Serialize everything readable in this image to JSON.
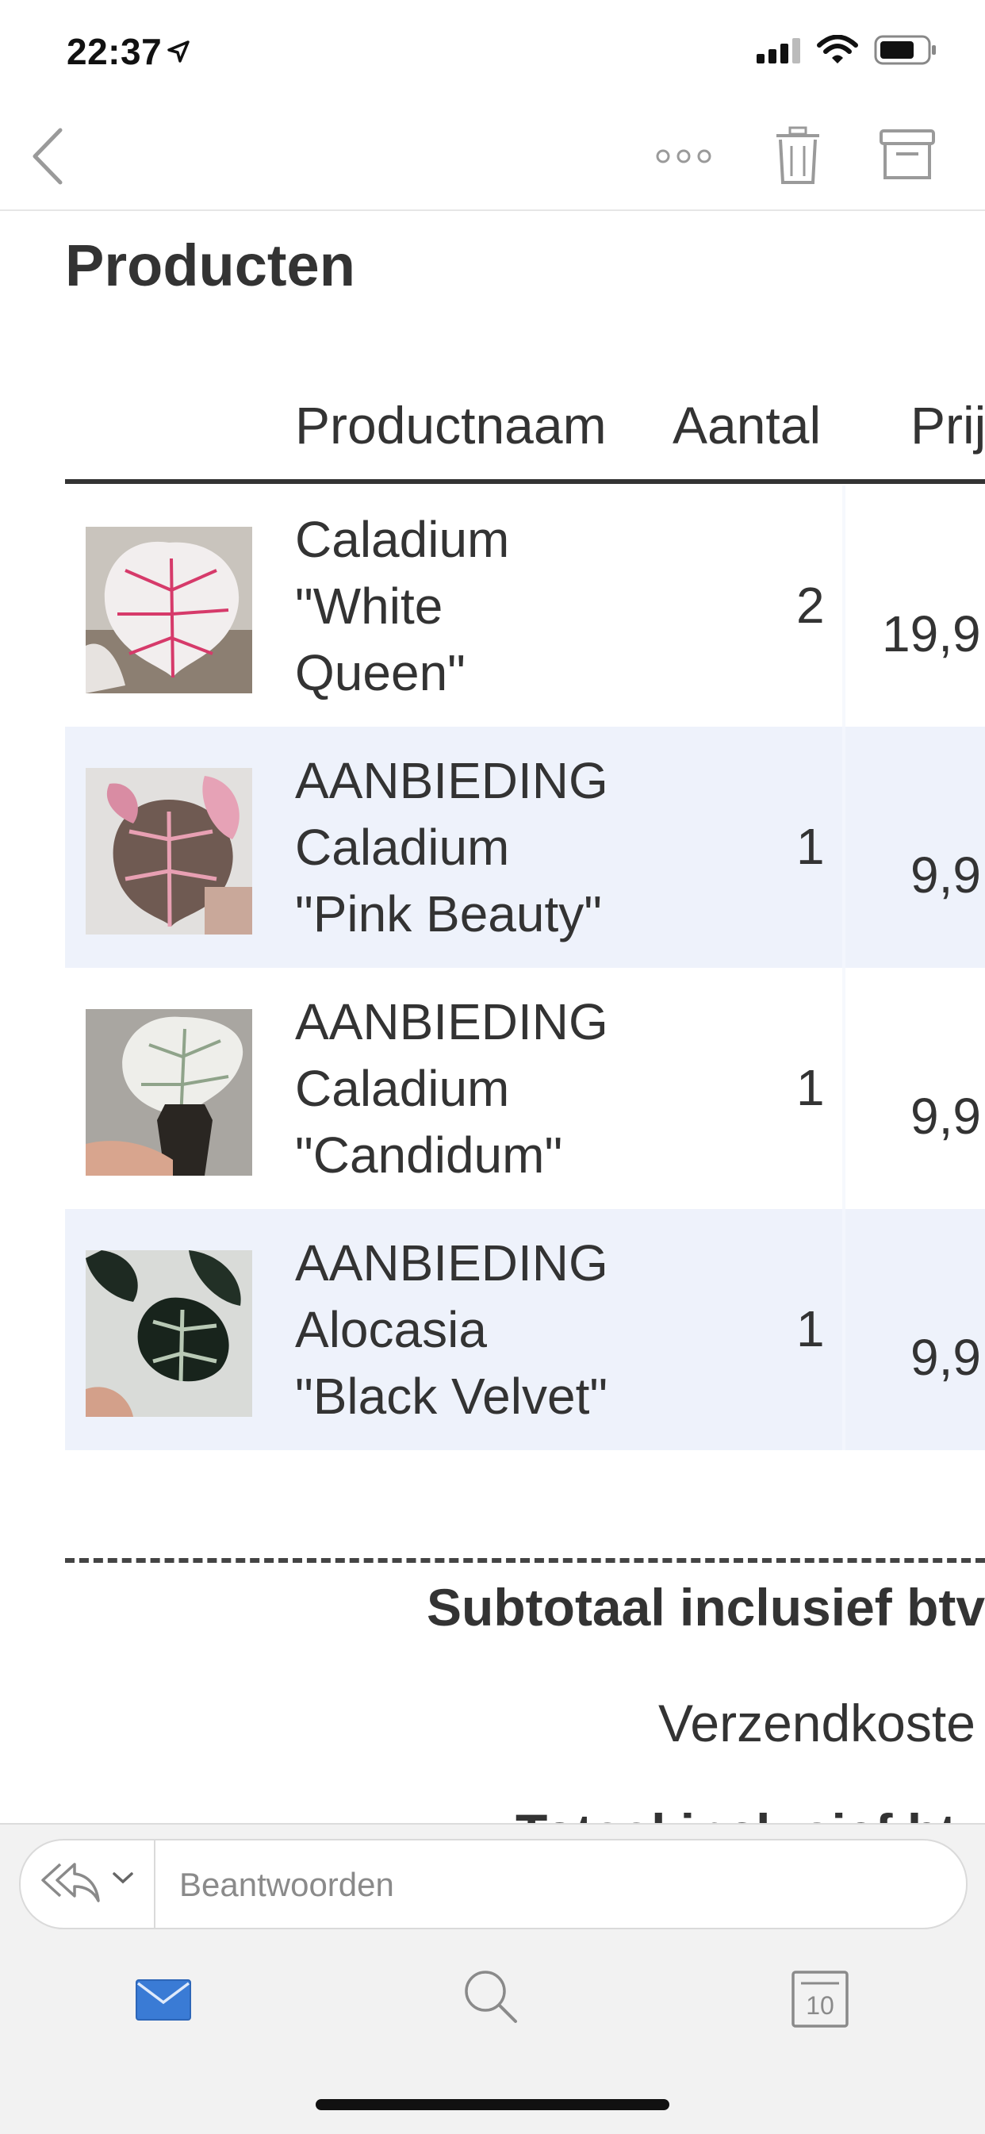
{
  "status_bar": {
    "time": "22:37",
    "icons": [
      "location-arrow-icon",
      "cellular-signal-icon",
      "wifi-icon",
      "battery-icon"
    ]
  },
  "toolbar": {
    "icons": [
      "back-chevron-icon",
      "more-dots-icon",
      "trash-icon",
      "archive-icon"
    ]
  },
  "products": {
    "title": "Producten",
    "columns": [
      "Productnaam",
      "Aantal",
      "Prij"
    ],
    "rows": [
      {
        "name": "Caladium\n\"White\nQueen\"",
        "qty": "2",
        "price": "19,9"
      },
      {
        "name": "AANBIEDING\nCaladium\n\"Pink Beauty\"",
        "qty": "1",
        "price": "9,9"
      },
      {
        "name": "AANBIEDING\nCaladium\n\"Candidum\"",
        "qty": "1",
        "price": "9,9"
      },
      {
        "name": "AANBIEDING\nAlocasia\n\"Black Velvet\"",
        "qty": "1",
        "price": "9,9"
      }
    ]
  },
  "summary": {
    "subtotal_label": "Subtotaal inclusief btv",
    "shipping_label": "Verzendkoste",
    "total_label": "Totaal inclusief btv"
  },
  "reply": {
    "placeholder": "Beantwoorden"
  },
  "tabs": {
    "calendar_day": "10"
  },
  "colors": {
    "accent": "#3a7bd5",
    "row_alt": "#eef2fb"
  }
}
